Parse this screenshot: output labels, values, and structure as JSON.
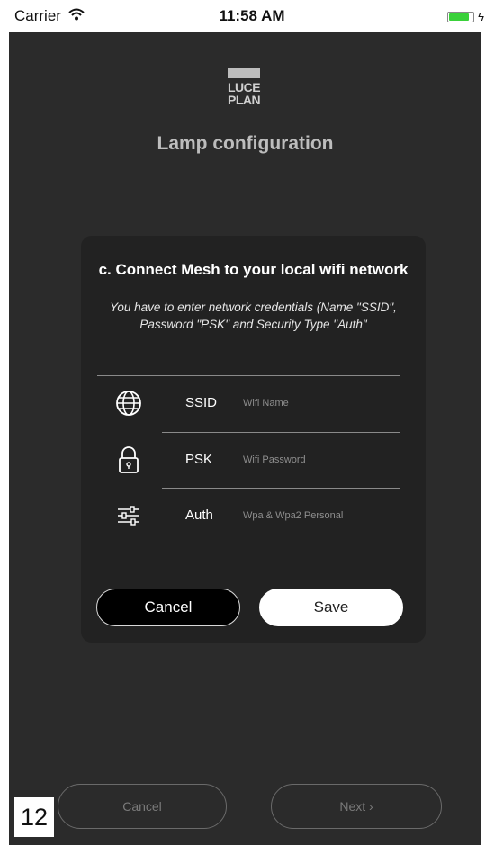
{
  "status_bar": {
    "carrier": "Carrier",
    "time": "11:58 AM",
    "battery_level": 0.85,
    "battery_color": "#3ad13a"
  },
  "header": {
    "logo_line1": "LUCE",
    "logo_line2": "PLAN",
    "title": "Lamp configuration"
  },
  "dialog": {
    "title": "c. Connect Mesh to your local wifi network",
    "description": "You have to enter network credentials (Name \"SSID\", Password \"PSK\" and Security Type \"Auth\"",
    "fields": [
      {
        "icon": "globe-icon",
        "label": "SSID",
        "value": "",
        "placeholder": "Wifi Name"
      },
      {
        "icon": "lock-icon",
        "label": "PSK",
        "value": "",
        "placeholder": "Wifi Password"
      },
      {
        "icon": "sliders-icon",
        "label": "Auth",
        "value": "",
        "placeholder": "Wpa & Wpa2 Personal"
      }
    ],
    "cancel_label": "Cancel",
    "save_label": "Save"
  },
  "footer": {
    "cancel_label": "Cancel",
    "next_label": "Next ›"
  },
  "page_number": "12",
  "colors": {
    "screen_bg": "#2b2b2b",
    "dialog_bg": "#222222",
    "accent_white": "#ffffff"
  }
}
